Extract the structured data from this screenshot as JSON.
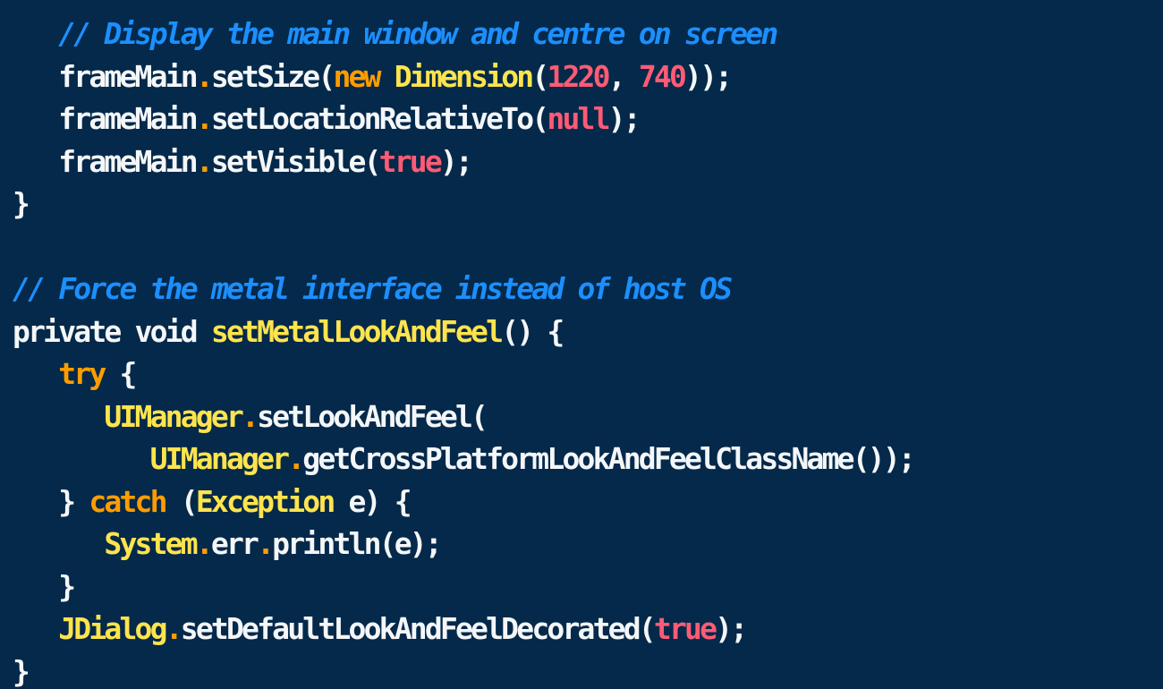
{
  "editor": {
    "theme": {
      "background": "#04294a",
      "comment": "#1c8fff",
      "keyword": "#ff9d00",
      "number": "#ff5b75",
      "identifier": "#ffe44d",
      "plain": "#f4f6f8"
    },
    "lines": [
      [
        {
          "t": "   ",
          "k": "pl"
        },
        {
          "t": "// Display the main window and centre on screen",
          "k": "cm"
        }
      ],
      [
        {
          "t": "   ",
          "k": "pl"
        },
        {
          "t": "frameMain",
          "k": "pl"
        },
        {
          "t": ".",
          "k": "dot"
        },
        {
          "t": "setSize(",
          "k": "pl"
        },
        {
          "t": "new",
          "k": "kw"
        },
        {
          "t": " ",
          "k": "pl"
        },
        {
          "t": "Dimension",
          "k": "ty"
        },
        {
          "t": "(",
          "k": "pl"
        },
        {
          "t": "1220",
          "k": "num"
        },
        {
          "t": ", ",
          "k": "pl"
        },
        {
          "t": "740",
          "k": "num"
        },
        {
          "t": "));",
          "k": "pl"
        }
      ],
      [
        {
          "t": "   ",
          "k": "pl"
        },
        {
          "t": "frameMain",
          "k": "pl"
        },
        {
          "t": ".",
          "k": "dot"
        },
        {
          "t": "setLocationRelativeTo(",
          "k": "pl"
        },
        {
          "t": "null",
          "k": "num"
        },
        {
          "t": ");",
          "k": "pl"
        }
      ],
      [
        {
          "t": "   ",
          "k": "pl"
        },
        {
          "t": "frameMain",
          "k": "pl"
        },
        {
          "t": ".",
          "k": "dot"
        },
        {
          "t": "setVisible(",
          "k": "pl"
        },
        {
          "t": "true",
          "k": "num"
        },
        {
          "t": ");",
          "k": "pl"
        }
      ],
      [
        {
          "t": "}",
          "k": "pl"
        }
      ],
      [],
      [
        {
          "t": "// Force the metal interface instead of host OS",
          "k": "cm"
        }
      ],
      [
        {
          "t": "private void ",
          "k": "pl"
        },
        {
          "t": "setMetalLookAndFeel",
          "k": "fn"
        },
        {
          "t": "() {",
          "k": "pl"
        }
      ],
      [
        {
          "t": "   ",
          "k": "pl"
        },
        {
          "t": "try",
          "k": "kw"
        },
        {
          "t": " {",
          "k": "pl"
        }
      ],
      [
        {
          "t": "      ",
          "k": "pl"
        },
        {
          "t": "UIManager",
          "k": "ty"
        },
        {
          "t": ".",
          "k": "dot"
        },
        {
          "t": "setLookAndFeel(",
          "k": "pl"
        }
      ],
      [
        {
          "t": "         ",
          "k": "pl"
        },
        {
          "t": "UIManager",
          "k": "ty"
        },
        {
          "t": ".",
          "k": "dot"
        },
        {
          "t": "getCrossPlatformLookAndFeelClassName());",
          "k": "pl"
        }
      ],
      [
        {
          "t": "   ",
          "k": "pl"
        },
        {
          "t": "} ",
          "k": "pl"
        },
        {
          "t": "catch",
          "k": "kw"
        },
        {
          "t": " (",
          "k": "pl"
        },
        {
          "t": "Exception",
          "k": "ty"
        },
        {
          "t": " e) {",
          "k": "pl"
        }
      ],
      [
        {
          "t": "      ",
          "k": "pl"
        },
        {
          "t": "System",
          "k": "ty"
        },
        {
          "t": ".",
          "k": "dot"
        },
        {
          "t": "err",
          "k": "pl"
        },
        {
          "t": ".",
          "k": "dot"
        },
        {
          "t": "println(e);",
          "k": "pl"
        }
      ],
      [
        {
          "t": "   ",
          "k": "pl"
        },
        {
          "t": "}",
          "k": "pl"
        }
      ],
      [
        {
          "t": "   ",
          "k": "pl"
        },
        {
          "t": "JDialog",
          "k": "ty"
        },
        {
          "t": ".",
          "k": "dot"
        },
        {
          "t": "setDefaultLookAndFeelDecorated(",
          "k": "pl"
        },
        {
          "t": "true",
          "k": "num"
        },
        {
          "t": ");",
          "k": "pl"
        }
      ],
      [
        {
          "t": "}",
          "k": "pl"
        }
      ]
    ]
  }
}
